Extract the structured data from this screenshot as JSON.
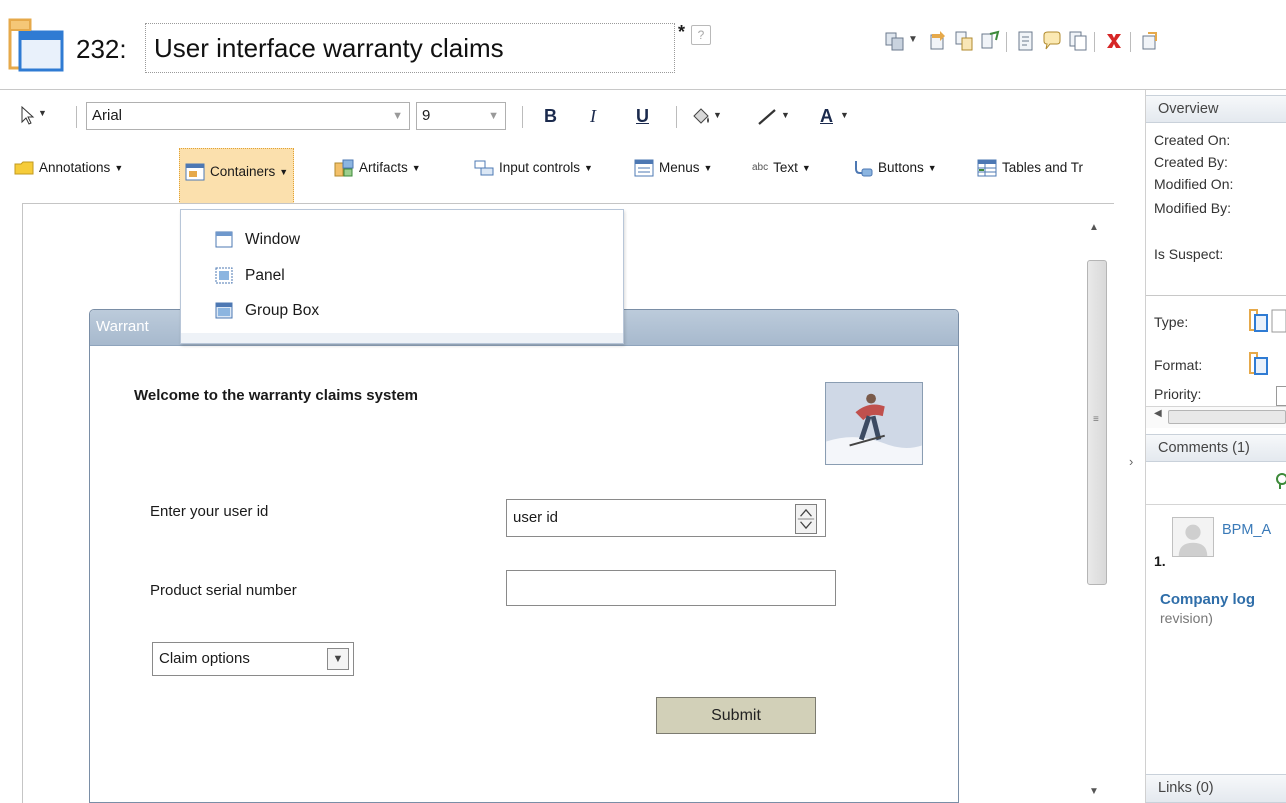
{
  "header": {
    "artifact_id": "232:",
    "title": "User interface warranty claims",
    "dirty_marker": "*",
    "help_glyph": "?"
  },
  "toolbar": {
    "font_family": "Arial",
    "font_size": "9",
    "bold_label": "B",
    "italic_label": "I",
    "underline_label": "U",
    "font_color_label": "A"
  },
  "palette": {
    "items": [
      {
        "label": "Annotations",
        "icon": "annotation-icon"
      },
      {
        "label": "Containers",
        "icon": "containers-icon"
      },
      {
        "label": "Artifacts",
        "icon": "artifacts-icon"
      },
      {
        "label": "Input controls",
        "icon": "input-controls-icon"
      },
      {
        "label": "Menus",
        "icon": "menus-icon"
      },
      {
        "label": "Text",
        "icon": "text-icon",
        "icon_text": "abc"
      },
      {
        "label": "Buttons",
        "icon": "buttons-icon"
      },
      {
        "label": "Tables and Tr",
        "icon": "tables-icon"
      }
    ]
  },
  "containers_menu": {
    "items": [
      {
        "label": "Window",
        "icon": "window-icon"
      },
      {
        "label": "Panel",
        "icon": "panel-icon"
      },
      {
        "label": "Group Box",
        "icon": "group-box-icon"
      }
    ]
  },
  "mockup": {
    "window_title": "Warrant",
    "welcome": "Welcome to the warranty claims system",
    "userid_label": "Enter your user id",
    "userid_value": "user id",
    "serial_label": "Product serial number",
    "serial_value": "",
    "claim_select_value": "Claim options",
    "submit_label": "Submit"
  },
  "right_pane": {
    "overview_title": "Overview",
    "created_on_label": "Created On:",
    "created_by_label": "Created By:",
    "modified_on_label": "Modified On:",
    "modified_by_label": "Modified By:",
    "is_suspect_label": "Is Suspect:",
    "type_label": "Type:",
    "format_label": "Format:",
    "priority_label": "Priority:",
    "comments_title": "Comments (1)",
    "comment_number": "1.",
    "comment_author": "BPM_A",
    "comment_title": "Company log",
    "comment_revision": "revision)",
    "links_title": "Links (0)"
  },
  "colors": {
    "accent_highlight": "#fbe0ad",
    "window_titlebar": "#a7b9cd",
    "submit_button": "#d2d0b8",
    "link_blue": "#2f6ea9"
  }
}
